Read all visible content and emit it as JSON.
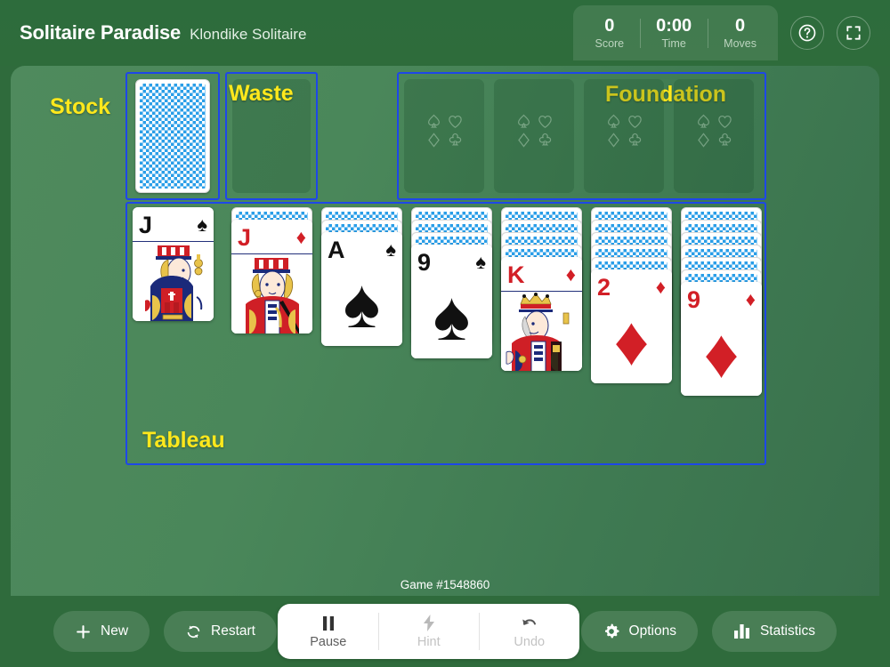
{
  "header": {
    "title": "Solitaire Paradise",
    "subtitle": "Klondike Solitaire",
    "stats": [
      {
        "value": "0",
        "label": "Score"
      },
      {
        "value": "0:00",
        "label": "Time"
      },
      {
        "value": "0",
        "label": "Moves"
      }
    ],
    "help_icon": "question-mark-circle-icon",
    "fullscreen_icon": "fullscreen-expand-icon"
  },
  "board": {
    "zones": {
      "stock_label": "Stock",
      "waste_label": "Waste",
      "foundation_label": "Foundation",
      "tableau_label": "Tableau"
    },
    "zone_border_color": "#1e47e8",
    "label_color": "#ffe81c",
    "stock": {
      "facedown_count": 1
    },
    "waste": {
      "cards": []
    },
    "foundation": {
      "piles": [
        {
          "cards": [],
          "placeholder_suits": [
            "spade",
            "heart",
            "diamond",
            "club"
          ]
        },
        {
          "cards": [],
          "placeholder_suits": [
            "spade",
            "heart",
            "diamond",
            "club"
          ]
        },
        {
          "cards": [],
          "placeholder_suits": [
            "spade",
            "heart",
            "diamond",
            "club"
          ]
        },
        {
          "cards": [],
          "placeholder_suits": [
            "spade",
            "heart",
            "diamond",
            "club"
          ]
        }
      ]
    },
    "tableau": {
      "columns": [
        {
          "facedown": 0,
          "faceup": [
            {
              "rank": "J",
              "suit": "spade",
              "color": "black",
              "art": "court"
            }
          ]
        },
        {
          "facedown": 1,
          "faceup": [
            {
              "rank": "J",
              "suit": "diamond",
              "color": "red",
              "art": "court"
            }
          ]
        },
        {
          "facedown": 2,
          "faceup": [
            {
              "rank": "A",
              "suit": "spade",
              "color": "black",
              "art": "pip"
            }
          ]
        },
        {
          "facedown": 3,
          "faceup": [
            {
              "rank": "9",
              "suit": "spade",
              "color": "black",
              "art": "pip"
            }
          ]
        },
        {
          "facedown": 4,
          "faceup": [
            {
              "rank": "K",
              "suit": "diamond",
              "color": "red",
              "art": "court"
            }
          ]
        },
        {
          "facedown": 5,
          "faceup": [
            {
              "rank": "2",
              "suit": "diamond",
              "color": "red",
              "art": "pip"
            }
          ]
        },
        {
          "facedown": 6,
          "faceup": [
            {
              "rank": "9",
              "suit": "diamond",
              "color": "red",
              "art": "pip"
            }
          ]
        }
      ]
    }
  },
  "footer": {
    "game_id": "Game #1548860",
    "left_buttons": [
      {
        "label": "New",
        "icon": "plus-icon"
      },
      {
        "label": "Restart",
        "icon": "refresh-icon"
      }
    ],
    "center_buttons": [
      {
        "label": "Pause",
        "icon": "pause-icon",
        "disabled": false
      },
      {
        "label": "Hint",
        "icon": "lightning-icon",
        "disabled": true
      },
      {
        "label": "Undo",
        "icon": "undo-arrow-icon",
        "disabled": true
      }
    ],
    "right_buttons": [
      {
        "label": "Options",
        "icon": "gear-icon"
      },
      {
        "label": "Statistics",
        "icon": "bar-chart-icon"
      }
    ]
  }
}
